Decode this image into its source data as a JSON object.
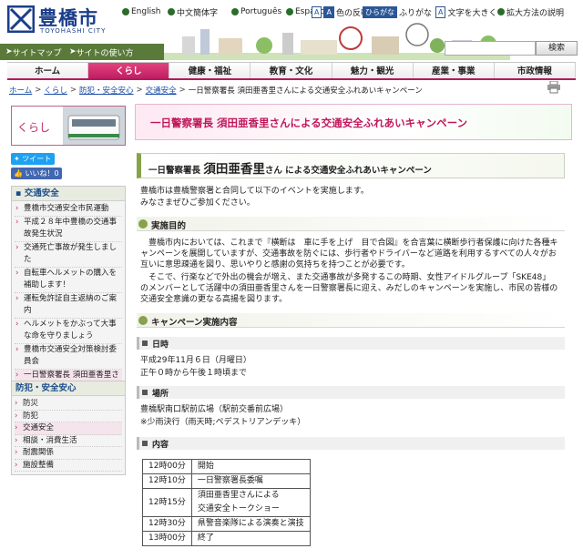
{
  "site": {
    "logo_jp": "豊橋市",
    "logo_en": "TOYOHASHI CITY"
  },
  "utility": {
    "english": "English",
    "chinese": "中文簡体字",
    "portuguese": "Português",
    "spanish": "Español",
    "color_invert": "色の反転",
    "furigana": "ふりがな",
    "text_larger": "文字を大きく",
    "zoom_method": "拡大方法の説明",
    "icon_a": "A",
    "icon_hiragana": "ひらがな"
  },
  "subnav": {
    "sitemap": "サイトマップ",
    "usage": "サイトの使い方"
  },
  "search": {
    "placeholder": "",
    "button": "検索"
  },
  "gnav": [
    "ホーム",
    "くらし",
    "健康・福祉",
    "教育・文化",
    "魅力・観光",
    "産業・事業",
    "市政情報"
  ],
  "breadcrumb": [
    "ホーム",
    "くらし",
    "防犯・安全安心",
    "交通安全",
    "一日警察署長 須田亜香里さんによる交通安全ふれあいキャンペーン"
  ],
  "side": {
    "category": "くらし",
    "tweet": "ツイート",
    "like": "いいね！0",
    "menu1_head": "交通安全",
    "menu1": [
      "豊橋市交通安全市民運動",
      "平成２８年中豊橋の交通事故発生状況",
      "交通死亡事故が発生しました",
      "自転車ヘルメットの購入を補助します！",
      "運転免許証自主返納のご案内",
      "ヘルメットをかぶって大事な命を守りましょう",
      "豊橋市交通安全対策検討委員会",
      "一日警察署長 須田亜香里さんによる交通安全ふれあいキャンペーン"
    ],
    "menu2_head": "防犯・安全安心",
    "menu2": [
      "防災",
      "防犯",
      "交通安全",
      "相談・消費生活",
      "耐震関係",
      "施設整備"
    ]
  },
  "main": {
    "banner": "一日警察署長 須田亜香里さんによる交通安全ふれあいキャンペーン",
    "title_pre": "一日警察署長",
    "title_name": "須田亜香里",
    "title_post": "さん による交通安全ふれあいキャンペーン",
    "intro1": "豊橋市は豊橋警察署と合同して以下のイベントを実施します。",
    "intro2": "みなさまぜひご参加ください。",
    "h_purpose": "実施目的",
    "purpose": [
      "　豊橋市内においては、これまで『横断は　車に手を上げ　目で合図』を合言葉に横断歩行者保護に向けた各種キ",
      "ャンペーンを展開していますが、交通事故を防ぐには、歩行者やドライバーなど道路を利用するすべての人々がお",
      "互いに意思疎通を図り、思いやりと感謝の気持ちを持つことが必要です。",
      "　そこで、行楽などで外出の機会が増え、また交通事故が多発するこの時期、女性アイドルグループ「SKE48」",
      "のメンバーとして活躍中の須田亜香里さんを一日警察署長に迎え、みだしのキャンペーンを実施し、市民の皆様の",
      "交通安全意識の更なる高揚を図ります。"
    ],
    "h_details": "キャンペーン実施内容",
    "h_date": "日時",
    "date": "平成29年11月６日（月曜日）",
    "time": "正午０時から午後１時頃まで",
    "h_place": "場所",
    "place": "豊橋駅南口駅前広場（駅前交番前広場）",
    "rain": "※少雨決行（雨天時;ペデストリアンデッキ）",
    "h_content": "内容",
    "schedule": [
      {
        "time": "12時00分",
        "event": "開始"
      },
      {
        "time": "12時10分",
        "event": "一日警察署長委嘱"
      },
      {
        "time": "12時15分",
        "event": "須田亜香里さんによる"
      },
      {
        "time": "",
        "event": "交通安全トークショー"
      },
      {
        "time": "12時30分",
        "event": "県警音楽隊による演奏と演技"
      },
      {
        "time": "13時00分",
        "event": "終了"
      }
    ]
  },
  "colors": {
    "brand_blue": "#1b3e8a",
    "accent_pink": "#c21e62",
    "green": "#86a24a"
  }
}
